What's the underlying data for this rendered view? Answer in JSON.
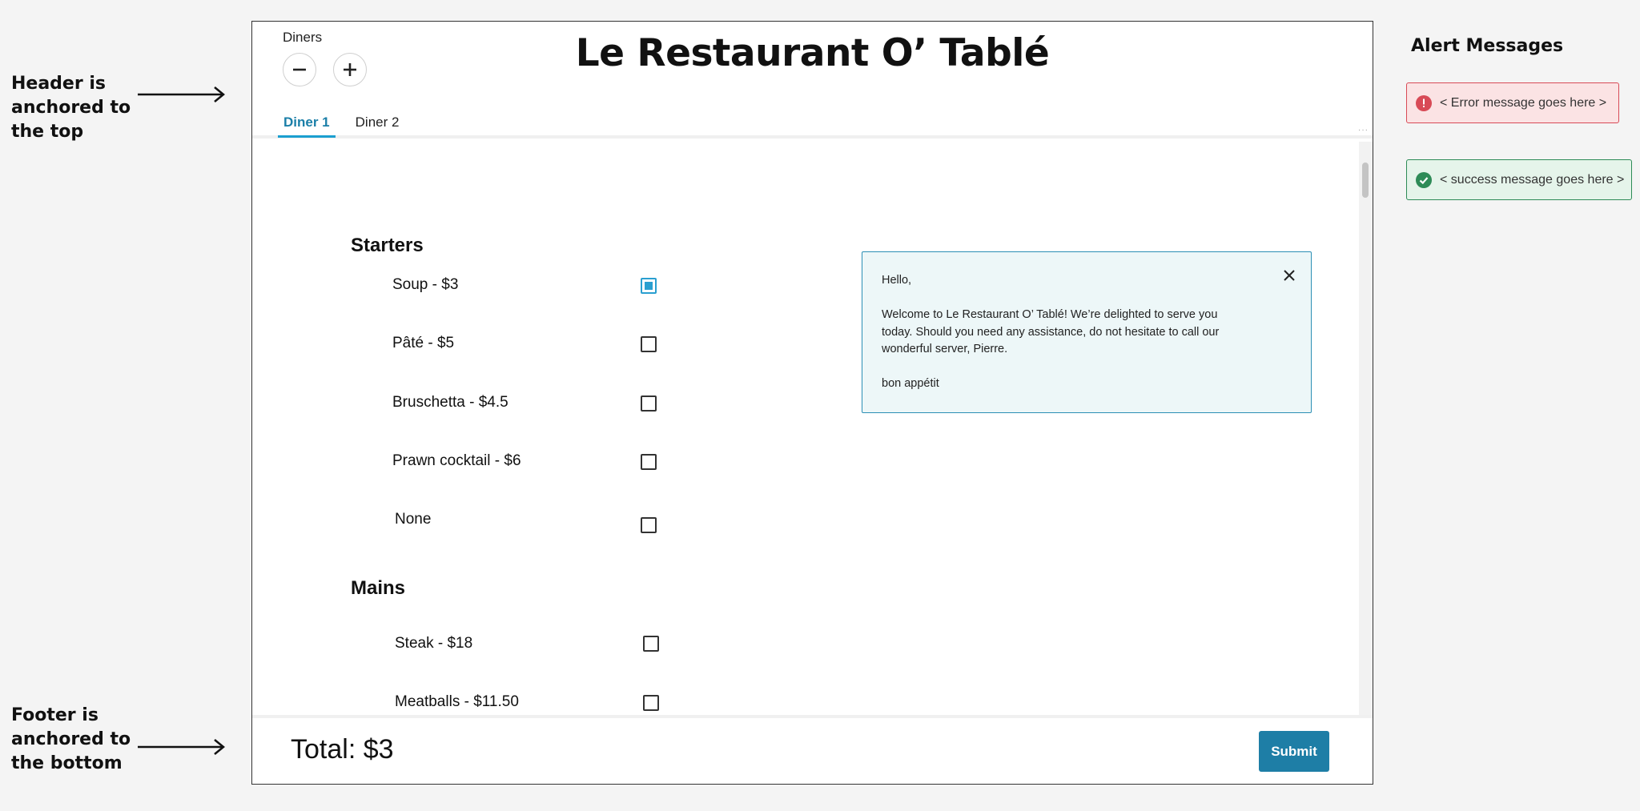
{
  "annotations": {
    "header_note": [
      "Header is",
      "anchored to",
      "the top"
    ],
    "footer_note": [
      "Footer is",
      "anchored to",
      "the bottom"
    ]
  },
  "header": {
    "diners_label": "Diners",
    "title": "Le Restaurant O’ Tablé",
    "tabs": [
      {
        "label": "Diner 1",
        "active": true
      },
      {
        "label": "Diner 2",
        "active": false
      }
    ]
  },
  "menu": {
    "starters": {
      "heading": "Starters",
      "items": [
        {
          "label": "Soup - $3",
          "checked": true
        },
        {
          "label": "Pâté - $5",
          "checked": false
        },
        {
          "label": "Bruschetta - $4.5",
          "checked": false
        },
        {
          "label": "Prawn cocktail - $6",
          "checked": false
        },
        {
          "label": "None",
          "checked": false
        }
      ]
    },
    "mains": {
      "heading": "Mains",
      "items": [
        {
          "label": "Steak - $18",
          "checked": false
        },
        {
          "label": "Meatballs - $11.50",
          "checked": false
        }
      ]
    }
  },
  "welcome": {
    "greeting": "Hello,",
    "body": "Welcome to Le Restaurant O’ Tablé! We’re delighted to serve you today. Should you need any assistance, do not hesitate to call our wonderful server, Pierre.",
    "signoff": "bon appétit"
  },
  "footer": {
    "total": "Total: $3",
    "submit_label": "Submit"
  },
  "alerts": {
    "title": "Alert Messages",
    "error_text": "< Error message goes here >",
    "success_text": "< success message goes here >"
  },
  "colors": {
    "accent": "#1e7ea6",
    "tab_active": "#1b9fd0",
    "error": "#d84a56",
    "success": "#2e8b57",
    "welcome_bg": "#edf7f8"
  },
  "icons": [
    "minus-icon",
    "plus-icon",
    "close-icon",
    "error-icon",
    "check-circle-icon",
    "arrow-right-icon"
  ]
}
